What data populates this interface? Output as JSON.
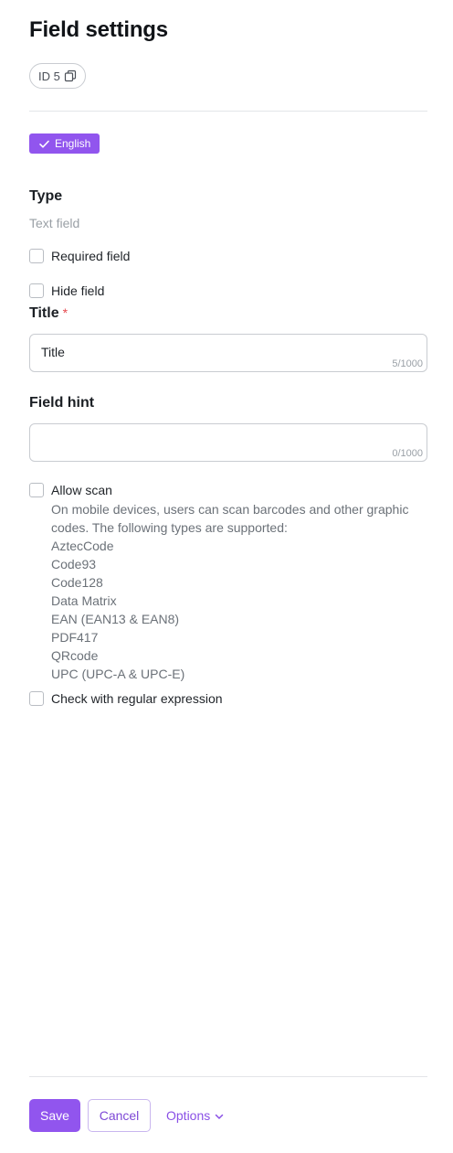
{
  "header": {
    "title": "Field settings",
    "id_chip": "ID 5",
    "copy_icon": "copy-icon"
  },
  "language": {
    "selected": "English",
    "icon": "check-icon",
    "color": "#9155ee"
  },
  "type": {
    "label": "Type",
    "value": "Text field"
  },
  "checkboxes": {
    "required": {
      "label": "Required field",
      "checked": false
    },
    "hide": {
      "label": "Hide field",
      "checked": false
    },
    "allow_scan": {
      "label": "Allow scan",
      "checked": false
    },
    "regex": {
      "label": "Check with regular expression",
      "checked": false
    }
  },
  "title_field": {
    "label": "Title",
    "required_mark": "*",
    "value": "Title",
    "counter_current": "5",
    "counter_max": "/1000"
  },
  "hint_field": {
    "label": "Field hint",
    "value": "",
    "counter_current": "0",
    "counter_max": "/1000"
  },
  "scan": {
    "description": "On mobile devices, users can scan barcodes and other graphic codes. The following types are supported:",
    "types": [
      "AztecCode",
      "Code93",
      "Code128",
      "Data Matrix",
      "EAN (EAN13 & EAN8)",
      "PDF417",
      "QRcode",
      "UPC (UPC-A & UPC-E)"
    ]
  },
  "footer": {
    "save_label": "Save",
    "cancel_label": "Cancel",
    "options_label": "Options",
    "options_icon": "chevron-down-icon",
    "accent_color": "#9155ee"
  }
}
